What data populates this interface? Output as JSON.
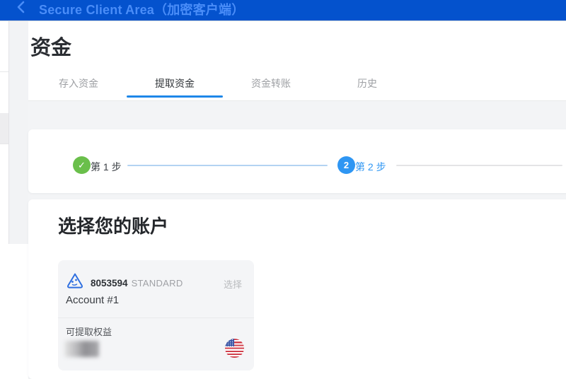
{
  "topbar": {
    "title": "Secure Client Area（加密客户端）"
  },
  "icons": {
    "back_chevron": "‹",
    "check": "✓"
  },
  "page": {
    "title": "资金"
  },
  "tabs": [
    {
      "label": "存入资金",
      "active": false
    },
    {
      "label": "提取资金",
      "active": true
    },
    {
      "label": "资金转账",
      "active": false
    },
    {
      "label": "历史",
      "active": false
    }
  ],
  "stepper": {
    "steps": [
      {
        "label": "第 1 步",
        "state": "completed"
      },
      {
        "label": "第 2 步",
        "state": "current",
        "number": "2"
      }
    ]
  },
  "section": {
    "heading": "选择您的账户"
  },
  "account_card": {
    "number": "8053594",
    "type": "STANDARD",
    "select_label": "选择",
    "name": "Account #1",
    "equity_label": "可提取权益",
    "equity_value_redacted": true,
    "currency_flag": "us-flag"
  },
  "colors": {
    "header_bg": "#0452cd",
    "header_text": "#4a8df8",
    "tab_underline": "#1e87e8",
    "step_done_green": "#6abf4b",
    "step_current_blue": "#2e96f3",
    "connector_blue": "#b3d3f2",
    "connector_gray": "#e4e4e6",
    "mt_icon_blue": "#2e6fe0",
    "us_flag_red": "#d0404c",
    "us_flag_blue": "#3f5ba9",
    "card_bg": "#f4f5f7"
  }
}
